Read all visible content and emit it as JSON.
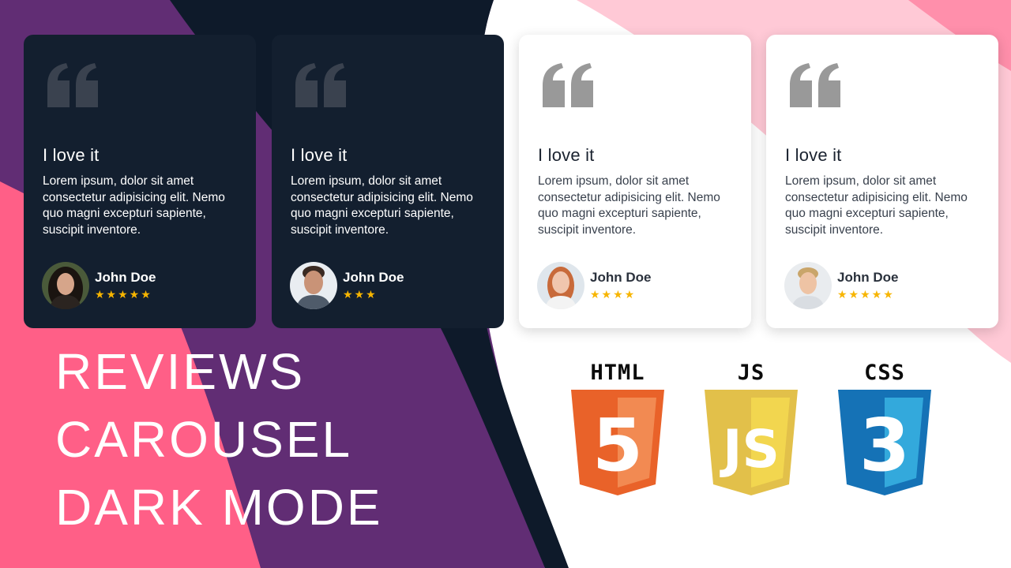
{
  "reviews": [
    {
      "theme": "dark",
      "title": "I love it",
      "text": "Lorem ipsum, dolor sit amet consectetur adipisicing elit. Nemo quo magni excepturi sapiente, suscipit inventore.",
      "author": "John Doe",
      "rating": 5,
      "stars": "★★★★★"
    },
    {
      "theme": "dark",
      "title": "I love it",
      "text": "Lorem ipsum, dolor sit amet consectetur adipisicing elit. Nemo quo magni excepturi sapiente, suscipit inventore.",
      "author": "John Doe",
      "rating": 3,
      "stars": "★★★"
    },
    {
      "theme": "light",
      "title": "I love it",
      "text": "Lorem ipsum, dolor sit amet consectetur adipisicing elit. Nemo quo magni excepturi sapiente, suscipit inventore.",
      "author": "John Doe",
      "rating": 4,
      "stars": "★★★★"
    },
    {
      "theme": "light",
      "title": "I love it",
      "text": "Lorem ipsum, dolor sit amet consectetur adipisicing elit. Nemo quo magni excepturi sapiente, suscipit inventore.",
      "author": "John Doe",
      "rating": 5,
      "stars": "★★★★★"
    }
  ],
  "headline": {
    "line1": "REVIEWS",
    "line2": "CAROUSEL",
    "line3": "DARK MODE"
  },
  "tech": {
    "html": {
      "label": "HTML",
      "glyph": "5",
      "color": "#e96229"
    },
    "js": {
      "label": "JS",
      "glyph": "JS",
      "color": "#e9c94a"
    },
    "css": {
      "label": "CSS",
      "glyph": "3",
      "color": "#1572b6"
    }
  },
  "colors": {
    "pink": "#ff5f87",
    "purple": "#612d74",
    "dark_navy": "#0e1a2a",
    "light_pink": "#ffc9d6",
    "star": "#f7b500"
  },
  "icons": {
    "quote": "quote-icon",
    "star": "star-icon"
  }
}
